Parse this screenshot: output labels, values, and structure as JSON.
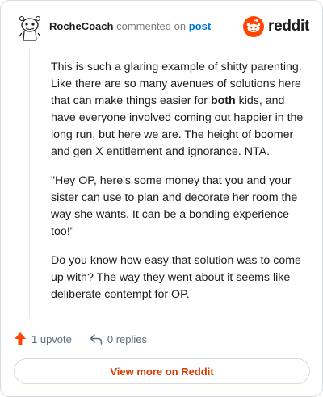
{
  "header": {
    "author": "RocheCoach",
    "action_text": "commented on",
    "post_link": "post",
    "brand": "reddit",
    "brand_color": "#ff4500",
    "avatar_icon": "snoo-avatar-icon"
  },
  "comment": {
    "p1_before": "This is such a glaring example of shitty parenting. Like there are so many avenues of solutions here that can make things easier for ",
    "p1_bold": "both",
    "p1_after": " kids, and have everyone involved coming out happier in the long run, but here we are. The height of boomer and gen X entitlement and ignorance. NTA.",
    "p2": "\"Hey OP, here's some money that you and your sister can use to plan and decorate her room the way she wants. It can be a bonding experience too!\"",
    "p3": "Do you know how easy that solution was to come up with? The way they went about it seems like deliberate contempt for OP."
  },
  "actions": {
    "upvotes": "1 upvote",
    "replies": "0 replies",
    "upvote_icon": "upvote-arrow-icon",
    "reply_icon": "reply-arrow-icon",
    "upvote_color": "#ff4500"
  },
  "footer": {
    "view_more": "View more on Reddit"
  }
}
